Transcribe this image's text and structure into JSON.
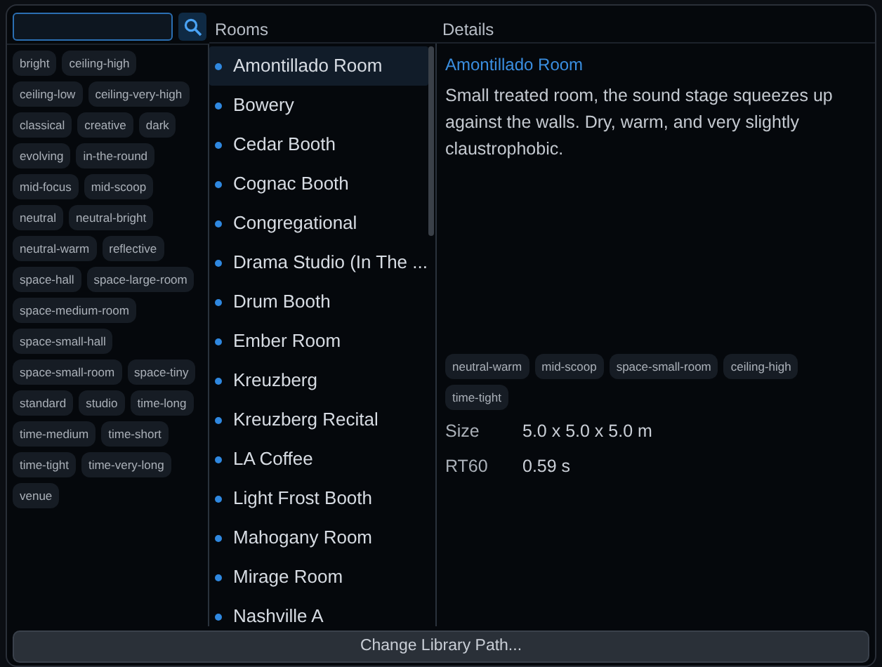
{
  "headers": {
    "rooms": "Rooms",
    "details": "Details"
  },
  "tags": [
    {
      "label": "bright"
    },
    {
      "label": "ceiling-high"
    },
    {
      "label": "ceiling-low"
    },
    {
      "label": "ceiling-very-high"
    },
    {
      "label": "classical"
    },
    {
      "label": "creative"
    },
    {
      "label": "dark"
    },
    {
      "label": "evolving"
    },
    {
      "label": "in-the-round"
    },
    {
      "label": "mid-focus"
    },
    {
      "label": "mid-scoop"
    },
    {
      "label": "neutral"
    },
    {
      "label": "neutral-bright"
    },
    {
      "label": "neutral-warm"
    },
    {
      "label": "reflective"
    },
    {
      "label": "space-hall"
    },
    {
      "label": "space-large-room"
    },
    {
      "label": "space-medium-room"
    },
    {
      "label": "space-small-hall"
    },
    {
      "label": "space-small-room"
    },
    {
      "label": "space-tiny"
    },
    {
      "label": "standard"
    },
    {
      "label": "studio"
    },
    {
      "label": "time-long"
    },
    {
      "label": "time-medium"
    },
    {
      "label": "time-short"
    },
    {
      "label": "time-tight"
    },
    {
      "label": "time-very-long"
    },
    {
      "label": "venue"
    }
  ],
  "rooms": [
    {
      "name": "Amontillado Room",
      "selected": true
    },
    {
      "name": "Bowery",
      "selected": false
    },
    {
      "name": "Cedar Booth",
      "selected": false
    },
    {
      "name": "Cognac Booth",
      "selected": false
    },
    {
      "name": "Congregational",
      "selected": false
    },
    {
      "name": "Drama Studio (In The ...",
      "selected": false
    },
    {
      "name": "Drum Booth",
      "selected": false
    },
    {
      "name": "Ember Room",
      "selected": false
    },
    {
      "name": "Kreuzberg",
      "selected": false
    },
    {
      "name": "Kreuzberg Recital",
      "selected": false
    },
    {
      "name": "LA Coffee",
      "selected": false
    },
    {
      "name": "Light Frost Booth",
      "selected": false
    },
    {
      "name": "Mahogany Room",
      "selected": false
    },
    {
      "name": "Mirage Room",
      "selected": false
    },
    {
      "name": "Nashville A",
      "selected": false
    }
  ],
  "details": {
    "title": "Amontillado Room",
    "description": "Small treated room, the sound stage squeezes up against the walls. Dry, warm, and very slightly claustrophobic.",
    "tags": [
      "neutral-warm",
      "mid-scoop",
      "space-small-room",
      "ceiling-high",
      "time-tight"
    ],
    "properties": [
      {
        "label": "Size",
        "value": "5.0 x 5.0 x 5.0 m"
      },
      {
        "label": "RT60",
        "value": "0.59 s"
      }
    ]
  },
  "footer_button": "Change Library Path..."
}
